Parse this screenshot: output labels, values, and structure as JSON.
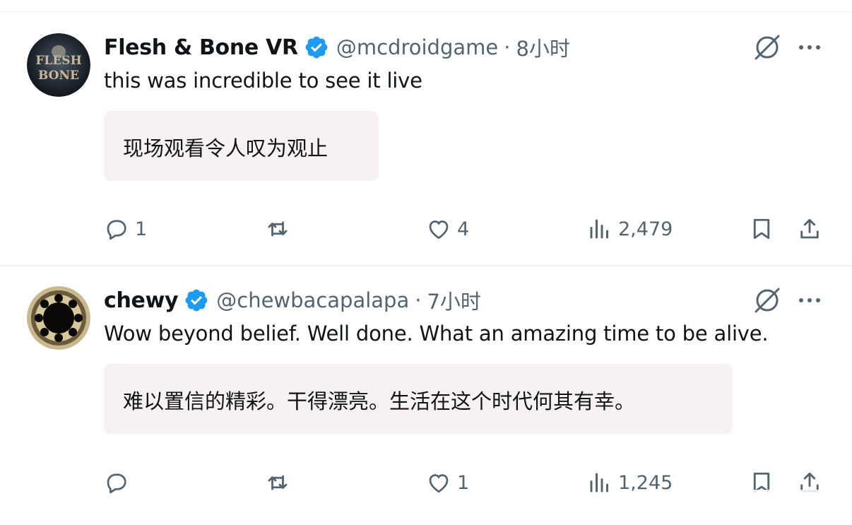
{
  "posts": [
    {
      "display_name": "Flesh & Bone VR",
      "handle": "@mcdroidgame",
      "separator": "·",
      "time": "8小时",
      "avatar_text": [
        "FLESH",
        "BONE"
      ],
      "text": "this was incredible to see it live",
      "translation": "现场观看令人叹为观止",
      "replies": "1",
      "reposts": "",
      "likes": "4",
      "views": "2,479"
    },
    {
      "display_name": "chewy",
      "handle": "@chewbacapalapa",
      "separator": "·",
      "time": "7小时",
      "text": "Wow beyond belief. Well done. What an amazing time to be alive.",
      "translation": "难以置信的精彩。干得漂亮。生活在这个时代何其有幸。",
      "replies": "",
      "reposts": "",
      "likes": "1",
      "views": "1,245"
    }
  ],
  "colors": {
    "text_primary": "#0f1419",
    "text_secondary": "#536471",
    "verified_blue": "#1d9bf0",
    "translation_bg": "#f7f1f1",
    "divider": "#eff3f4"
  },
  "icons": [
    "verified-badge-icon",
    "grok-icon",
    "more-icon",
    "reply-icon",
    "repost-icon",
    "like-icon",
    "views-icon",
    "bookmark-icon",
    "share-icon"
  ]
}
